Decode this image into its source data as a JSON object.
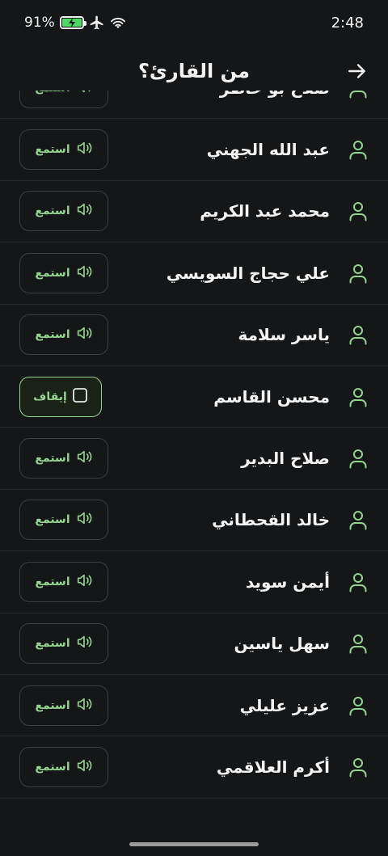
{
  "status_bar": {
    "battery_percent": "91%",
    "time": "2:48"
  },
  "header": {
    "title": "من القارئ؟"
  },
  "colors": {
    "accent": "#93d48e",
    "background": "#141618",
    "divider": "#24282b"
  },
  "reciters": [
    {
      "name": "صلاح بو خاطر",
      "button_label": "استمع",
      "button_icon": "speaker-icon",
      "playing": false
    },
    {
      "name": "عبد الله الجهني",
      "button_label": "استمع",
      "button_icon": "speaker-icon",
      "playing": false
    },
    {
      "name": "محمد عبد الكريم",
      "button_label": "استمع",
      "button_icon": "speaker-icon",
      "playing": false
    },
    {
      "name": "علي حجاج السويسي",
      "button_label": "استمع",
      "button_icon": "speaker-icon",
      "playing": false
    },
    {
      "name": "ياسر سلامة",
      "button_label": "استمع",
      "button_icon": "speaker-icon",
      "playing": false
    },
    {
      "name": "محسن القاسم",
      "button_label": "إيقاف",
      "button_icon": "stop-icon",
      "playing": true
    },
    {
      "name": "صلاح البدير",
      "button_label": "استمع",
      "button_icon": "speaker-icon",
      "playing": false
    },
    {
      "name": "خالد القحطاني",
      "button_label": "استمع",
      "button_icon": "speaker-icon",
      "playing": false
    },
    {
      "name": "أيمن سويد",
      "button_label": "استمع",
      "button_icon": "speaker-icon",
      "playing": false
    },
    {
      "name": "سهل ياسين",
      "button_label": "استمع",
      "button_icon": "speaker-icon",
      "playing": false
    },
    {
      "name": "عزيز عليلي",
      "button_label": "استمع",
      "button_icon": "speaker-icon",
      "playing": false
    },
    {
      "name": "أكرم العلاقمي",
      "button_label": "استمع",
      "button_icon": "speaker-icon",
      "playing": false
    }
  ]
}
